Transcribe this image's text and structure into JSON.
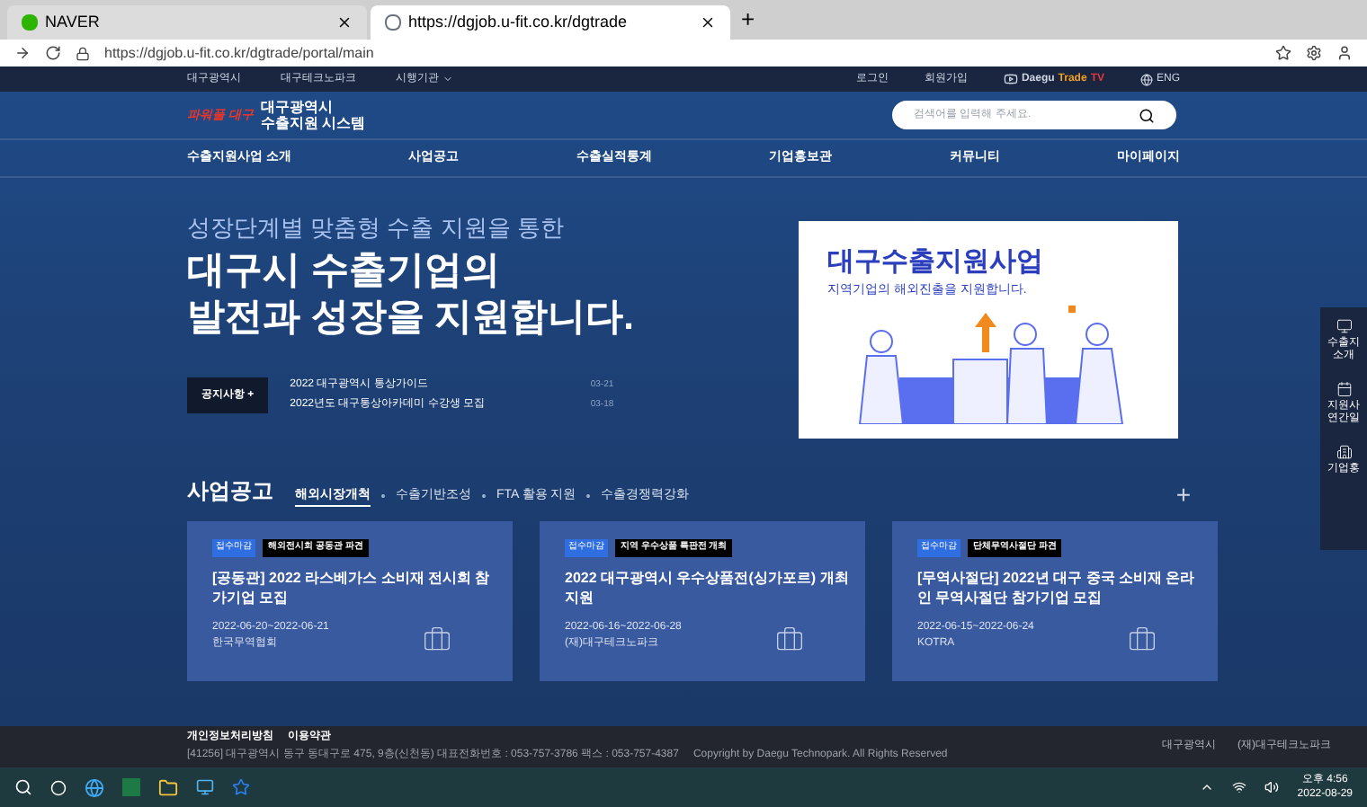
{
  "browser": {
    "tabs": [
      {
        "title": "NAVER",
        "selected": false
      },
      {
        "title": "https://dgjob.u-fit.co.kr/dgtrade",
        "selected": true
      }
    ],
    "new_tab": "+",
    "url": "https://dgjob.u-fit.co.kr/dgtrade/portal/main"
  },
  "top_bar": {
    "left_links": [
      "대구광역시",
      "대구테크노파크",
      "시행기관"
    ],
    "right_links": [
      "로그인",
      "회원가입"
    ],
    "tv": {
      "prefix": "Daegu ",
      "highlight": "Trade",
      "suffix": " TV"
    },
    "lang": "ENG"
  },
  "header": {
    "logo_small": "파워풀 대구",
    "logo_title_1": "대구광역시",
    "logo_title_2": "수출지원 시스템",
    "search": {
      "placeholder": "검색어를 입력해 주세요."
    }
  },
  "nav": [
    "수출지원사업 소개",
    "사업공고",
    "수출실적통계",
    "기업홍보관",
    "커뮤니티",
    "마이페이지"
  ],
  "hero": {
    "subtitle": "성장단계별 맞춤형 수출 지원을 통한",
    "title_1": "대구시 수출기업의",
    "title_2": "발전과 성장을 지원합니다.",
    "banner": {
      "title": "대구수출지원사업",
      "text": "지역기업의 해외진출을 지원합니다."
    }
  },
  "notice": {
    "button": "공지사항 +",
    "items": [
      {
        "title": "2022 대구광역시 통상가이드",
        "date": "03-21"
      },
      {
        "title": "2022년도 대구통상아카데미 수강생 모집",
        "date": "03-18"
      }
    ]
  },
  "business": {
    "title": "사업공고",
    "tabs": [
      {
        "label": "해외시장개척",
        "selected": true
      },
      {
        "label": "수출기반조성",
        "selected": false
      },
      {
        "label": "FTA 활용 지원",
        "selected": false
      },
      {
        "label": "수출경쟁력강화",
        "selected": false
      }
    ],
    "more": "+",
    "cards": [
      {
        "status": "접수마감",
        "tag": "해외전시회 공동관 파견",
        "title": "[공동관] 2022 라스베가스 소비재 전시회 참가기업 모집",
        "period": "2022-06-20~2022-06-21",
        "org": "한국무역협회"
      },
      {
        "status": "접수마감",
        "tag": "지역 우수상품 특판전 개최",
        "title": "2022 대구광역시 우수상품전(싱가포르) 개최 지원",
        "period": "2022-06-16~2022-06-28",
        "org": "(재)대구테크노파크"
      },
      {
        "status": "접수마감",
        "tag": "단체무역사절단 파견",
        "title": "[무역사절단] 2022년 대구 중국 소비재 온라인 무역사절단 참가기업 모집",
        "period": "2022-06-15~2022-06-24",
        "org": "KOTRA"
      }
    ]
  },
  "quick_menu": [
    "수출지 소개",
    "지원사 연간일",
    "기업홍"
  ],
  "footer": {
    "links": [
      "개인정보처리방침",
      "이용약관"
    ],
    "address": "[41256] 대구광역시 동구 동대구로 475, 9층(신천동) 대표전화번호 : 053-757-3786 팩스 : 053-757-4387",
    "copyright": "Copyright by Daegu Technopark. All Rights Reserved",
    "logos": [
      "대구광역시",
      "(재)대구테크노파크"
    ]
  },
  "taskbar": {
    "time": "오후 4:56",
    "date": "2022-08-29"
  }
}
